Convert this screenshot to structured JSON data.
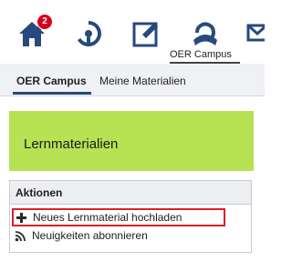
{
  "topnav": {
    "badge_count": "2",
    "items": [
      {
        "icon": "home-icon"
      },
      {
        "icon": "activity-icon"
      },
      {
        "icon": "edit-icon"
      },
      {
        "icon": "oer-campus-icon",
        "label": "OER Campus",
        "active": true
      },
      {
        "icon": "overflow-icon"
      }
    ]
  },
  "tabs": [
    {
      "label": "OER Campus",
      "active": true
    },
    {
      "label": "Meine Materialien",
      "active": false
    }
  ],
  "header": {
    "title": "Lernmaterialien",
    "color": "#b6e254"
  },
  "actions": {
    "title": "Aktionen",
    "items": [
      {
        "icon": "plus-icon",
        "label": "Neues Lernmaterial hochladen",
        "highlighted": true
      },
      {
        "icon": "rss-icon",
        "label": "Neuigkeiten abonnieren",
        "highlighted": false
      }
    ]
  },
  "colors": {
    "icon_blue": "#28497c",
    "badge_red": "#d6001c",
    "highlight_red": "#dc1f26"
  }
}
